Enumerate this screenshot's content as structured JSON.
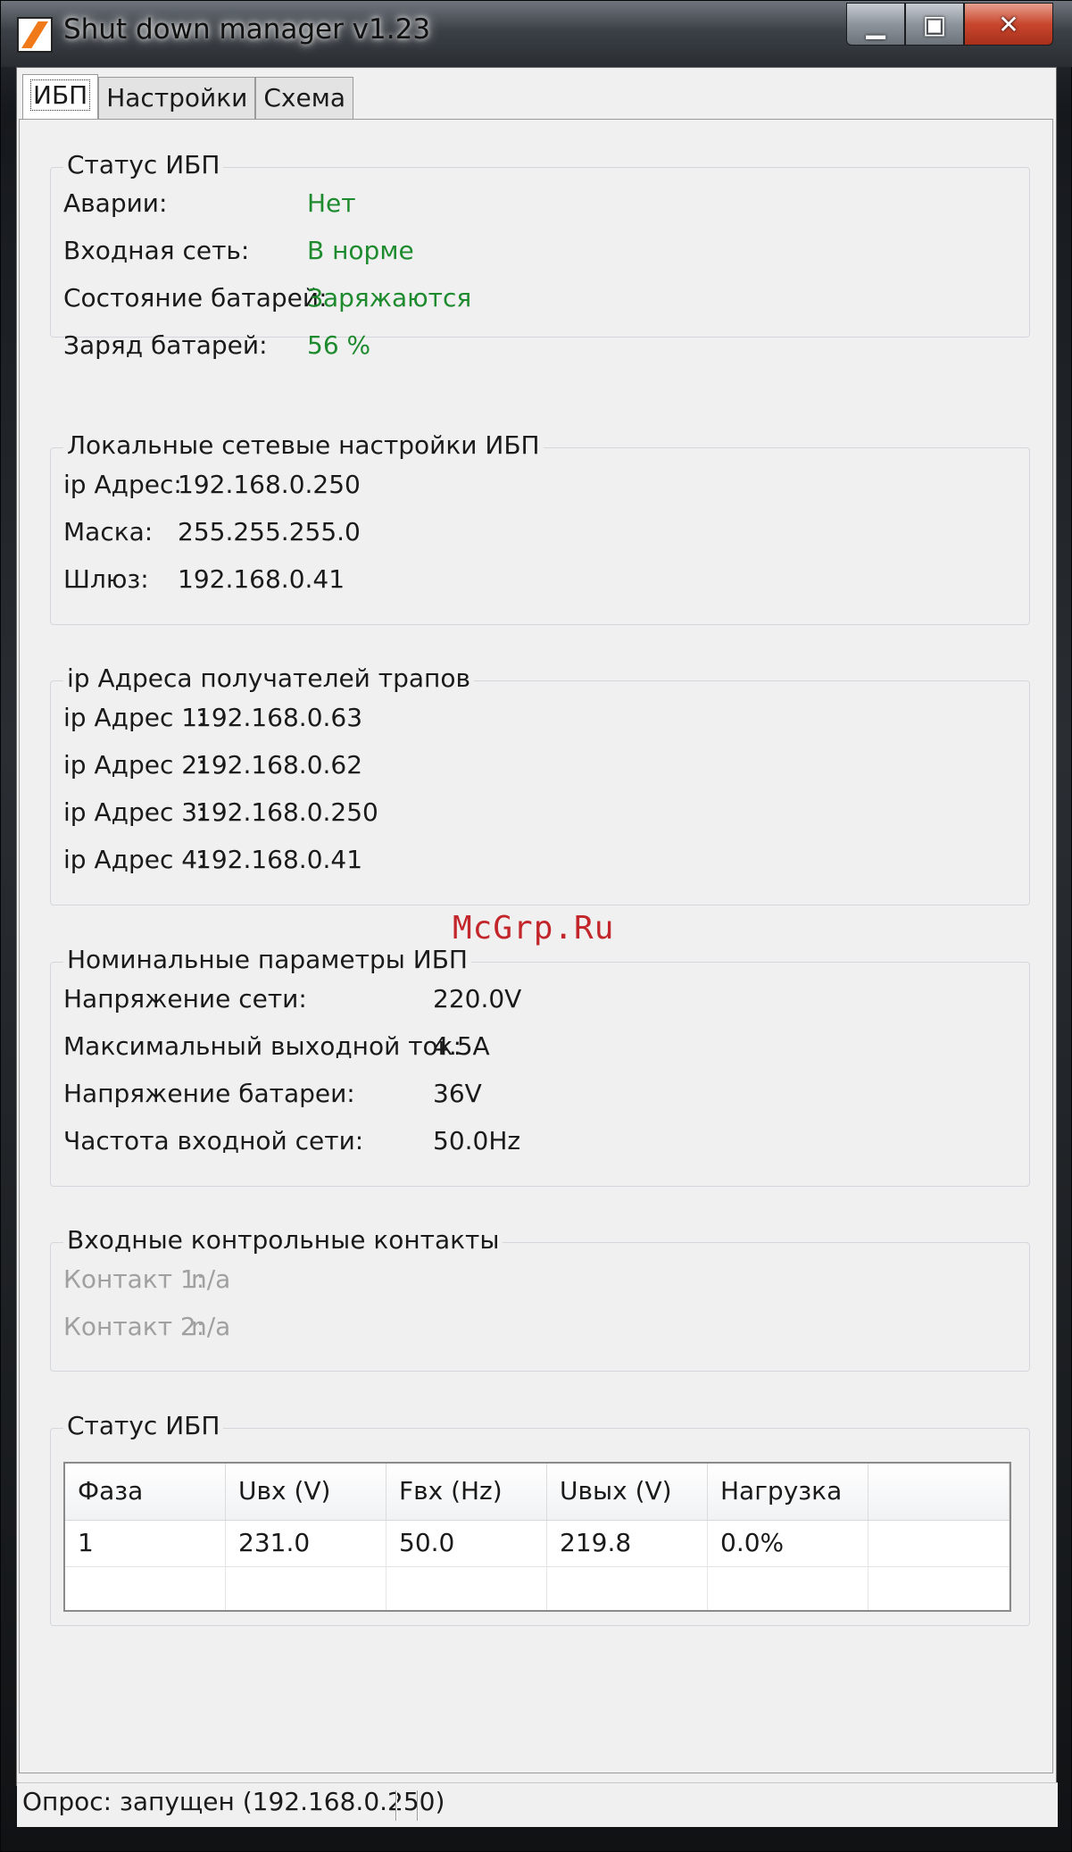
{
  "window": {
    "title": "Shut down manager  v1.23",
    "minimize_glyph": "▁",
    "maximize_glyph": "▣",
    "close_glyph": "✕"
  },
  "tabs": [
    {
      "label": "ИБП",
      "active": true
    },
    {
      "label": "Настройки",
      "active": false
    },
    {
      "label": "Схема",
      "active": false
    }
  ],
  "ups_status": {
    "title": "Статус ИБП",
    "rows": [
      {
        "label": "Аварии:",
        "value": "Нет"
      },
      {
        "label": "Входная сеть:",
        "value": "В норме"
      },
      {
        "label": "Состояние батарей:",
        "value": "Заряжаются"
      },
      {
        "label": "Заряд батарей:",
        "value": "56 %"
      }
    ],
    "value_color": "#1e8a2e"
  },
  "network": {
    "title": "Локальные сетевые настройки ИБП",
    "rows": [
      {
        "label": "ip Адрес:",
        "value": "192.168.0.250"
      },
      {
        "label": "Маска:",
        "value": "255.255.255.0"
      },
      {
        "label": "Шлюз:",
        "value": "192.168.0.41"
      }
    ]
  },
  "trap_receivers": {
    "title": "ip Адреса получателей трапов",
    "rows": [
      {
        "label": "ip Адрес 1:",
        "value": "192.168.0.63"
      },
      {
        "label": "ip Адрес 2:",
        "value": "192.168.0.62"
      },
      {
        "label": "ip Адрес 3:",
        "value": "192.168.0.250"
      },
      {
        "label": "ip Адрес 4:",
        "value": "192.168.0.41"
      }
    ]
  },
  "nominal": {
    "title": "Номинальные параметры ИБП",
    "rows": [
      {
        "label": "Напряжение сети:",
        "value": "220.0V"
      },
      {
        "label": "Максимальный выходной ток:",
        "value": "4.5A"
      },
      {
        "label": "Напряжение батареи:",
        "value": "36V"
      },
      {
        "label": "Частота входной сети:",
        "value": "50.0Hz"
      }
    ]
  },
  "contacts": {
    "title": "Входные контрольные контакты",
    "rows": [
      {
        "label": "Контакт 1:",
        "value": "n/a"
      },
      {
        "label": "Контакт 2:",
        "value": "n/a"
      }
    ]
  },
  "phase_status": {
    "title": "Статус ИБП",
    "columns": [
      "Фаза",
      "Uвх (V)",
      "Fвх (Hz)",
      "Uвых (V)",
      "Нагрузка"
    ],
    "rows": [
      [
        "1",
        "231.0",
        "50.0",
        "219.8",
        "0.0%"
      ]
    ]
  },
  "statusbar": {
    "text": "Опрос: запущен (192.168.0.250)"
  },
  "watermark": "McGrp.Ru",
  "colors": {
    "accent_icon": "#f07a1a",
    "ok_green": "#1e8a2e",
    "disabled_grey": "#a0a0a0",
    "close_red": "#c9462e",
    "watermark_red": "#c3262a"
  }
}
